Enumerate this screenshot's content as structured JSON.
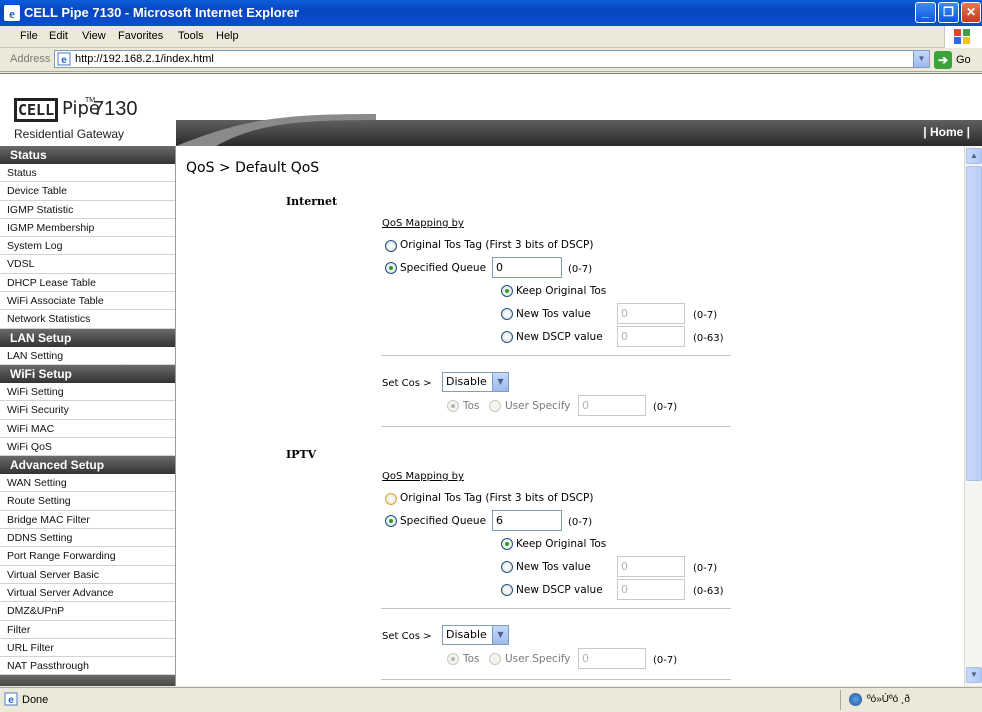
{
  "window": {
    "title": "CELL Pipe 7130 - Microsoft Internet Explorer"
  },
  "menu": [
    "File",
    "Edit",
    "View",
    "Favorites",
    "Tools",
    "Help"
  ],
  "address": {
    "label": "Address",
    "url": "http://192.168.2.1/index.html",
    "go_label": "Go"
  },
  "logo": {
    "brand": "CELL",
    "brand_suffix": "Pipe",
    "tm": "TM",
    "model": "7130",
    "subtitle": "Residential Gateway"
  },
  "header": {
    "home_link": "| Home |"
  },
  "sidebar": {
    "status_head": "Status",
    "status_items": [
      "Status",
      "Device Table",
      "IGMP Statistic",
      "IGMP Membership",
      "System Log",
      "VDSL",
      "DHCP Lease Table",
      "WiFi Associate Table",
      "Network Statistics"
    ],
    "lan_head": "LAN Setup",
    "lan_items": [
      "LAN Setting"
    ],
    "wifi_head": "WiFi Setup",
    "wifi_items": [
      "WiFi Setting",
      "WiFi Security",
      "WiFi MAC",
      "WiFi QoS"
    ],
    "adv_head": "Advanced Setup",
    "adv_items": [
      "WAN Setting",
      "Route Setting",
      "Bridge MAC Filter",
      "DDNS Setting",
      "Port Range Forwarding",
      "Virtual Server Basic",
      "Virtual Server Advance",
      "DMZ&UPnP",
      "Filter",
      "URL Filter",
      "NAT Passthrough"
    ]
  },
  "page": {
    "title": "QoS > Default QoS",
    "sections": [
      {
        "name": "Internet",
        "mapping_label": "QoS Mapping by",
        "opt_original": "Original Tos Tag (First 3 bits of DSCP)",
        "opt_specified": "Specified Queue",
        "queue_value": "0",
        "queue_range": "(0-7)",
        "keep_original": "Keep Original Tos",
        "new_tos": "New Tos value",
        "new_tos_value": "0",
        "new_tos_range": "(0-7)",
        "new_dscp": "New DSCP value",
        "new_dscp_value": "0",
        "new_dscp_range": "(0-63)",
        "set_cos_label": "Set Cos >",
        "set_cos_value": "Disable",
        "cos_tos": "Tos",
        "cos_user": "User Specify",
        "cos_user_value": "0",
        "cos_range": "(0-7)"
      },
      {
        "name": "IPTV",
        "mapping_label": "QoS Mapping by",
        "opt_original": "Original Tos Tag (First 3 bits of DSCP)",
        "opt_specified": "Specified Queue",
        "queue_value": "6",
        "queue_range": "(0-7)",
        "keep_original": "Keep Original Tos",
        "new_tos": "New Tos value",
        "new_tos_value": "0",
        "new_tos_range": "(0-7)",
        "new_dscp": "New DSCP value",
        "new_dscp_value": "0",
        "new_dscp_range": "(0-63)",
        "set_cos_label": "Set Cos >",
        "set_cos_value": "Disable",
        "cos_tos": "Tos",
        "cos_user": "User Specify",
        "cos_user_value": "0",
        "cos_range": "(0-7)"
      }
    ]
  },
  "statusbar": {
    "text": "Done",
    "zone": "ºó»Úºó ¸ð"
  }
}
